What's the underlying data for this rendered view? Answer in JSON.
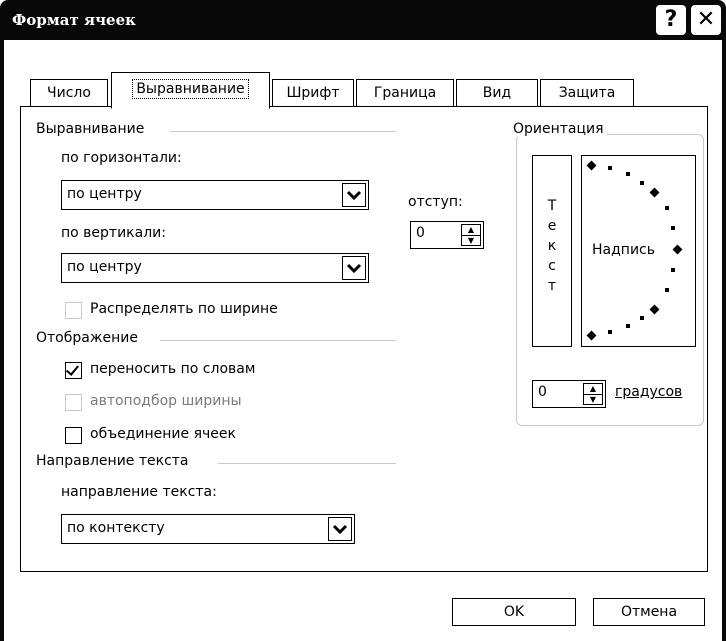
{
  "window": {
    "title": "Формат ячеек",
    "help_glyph": "?",
    "close_glyph": "✕"
  },
  "tabs": [
    {
      "label": "Число"
    },
    {
      "label": "Выравнивание"
    },
    {
      "label": "Шрифт"
    },
    {
      "label": "Граница"
    },
    {
      "label": "Вид"
    },
    {
      "label": "Защита"
    }
  ],
  "alignment": {
    "group_title": "Выравнивание",
    "horizontal_label": "по горизонтали:",
    "horizontal_value": "по центру",
    "vertical_label": "по вертикали:",
    "vertical_value": "по центру",
    "indent_label": "отступ:",
    "indent_value": "0",
    "distribute_label": "Распределять по ширине"
  },
  "display": {
    "group_title": "Отображение",
    "wrap_label": "переносить по словам",
    "wrap_checked": true,
    "shrink_label": "автоподбор ширины",
    "merge_label": "объединение ячеек",
    "merge_checked": false
  },
  "text_direction": {
    "group_title": "Направление текста",
    "label": "направление текста:",
    "value": "по контексту"
  },
  "orientation": {
    "group_title": "Ориентация",
    "vertical_text": [
      "Т",
      "е",
      "к",
      "с",
      "т"
    ],
    "dial_label": "Надпись",
    "degrees_value": "0",
    "degrees_label": "градусов"
  },
  "buttons": {
    "ok": "OK",
    "cancel": "Отмена"
  },
  "icons": {
    "dropdown": "chevron-down-icon",
    "spin": "spin-arrows-icon",
    "close": "close-icon",
    "help": "help-icon"
  }
}
